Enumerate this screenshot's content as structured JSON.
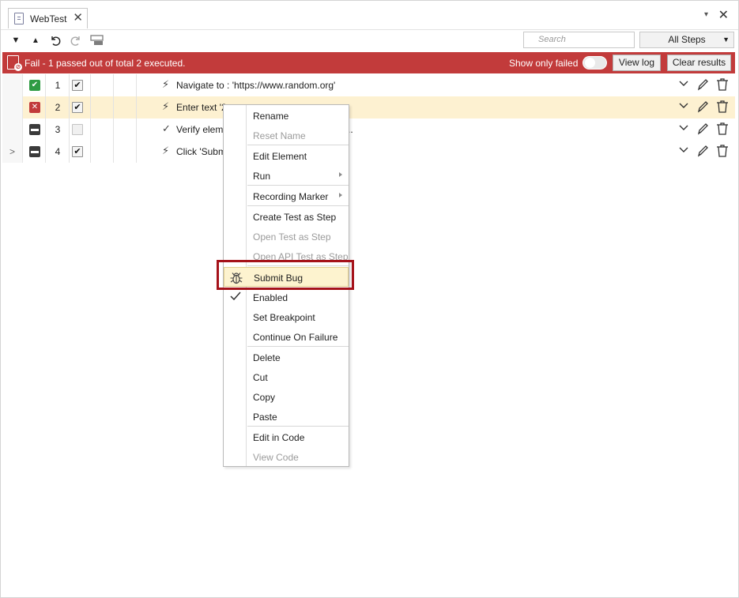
{
  "tab": {
    "title": "WebTest",
    "close": "✕"
  },
  "window": {
    "menu": "▾",
    "close": "✕"
  },
  "toolbar": {
    "collapse_all": "▼",
    "expand_all": "▲",
    "search_placeholder": "Search",
    "steps_filter": "All Steps",
    "steps_caret": "▼"
  },
  "status": {
    "message": "Fail - 1 passed out of total 2 executed.",
    "show_only_failed": "Show only failed",
    "show_only_failed_on": false,
    "view_log": "View log",
    "clear_results": "Clear results",
    "color": "#c23b3b"
  },
  "steps": [
    {
      "num": "1",
      "result": "pass",
      "result_glyph": "✔",
      "enabled": true,
      "check_glyph": "✔",
      "icon": "⚡",
      "text": "Navigate to : 'https://www.random.org'",
      "expander": ""
    },
    {
      "num": "2",
      "result": "fail",
      "result_glyph": "✕",
      "enabled": true,
      "check_glyph": "✔",
      "icon": "⚡",
      "text": "Enter text '2",
      "expander": ""
    },
    {
      "num": "3",
      "result": "skip",
      "result_glyph": "▬",
      "enabled": false,
      "check_glyph": "",
      "icon": "✓",
      "text": "Verify elem",
      "text_tail": "..",
      "expander": ""
    },
    {
      "num": "4",
      "result": "skip",
      "result_glyph": "▬",
      "enabled": true,
      "check_glyph": "✔",
      "icon": "⚡",
      "text": "Click 'Subm",
      "expander": ">"
    }
  ],
  "context_menu": {
    "items": [
      {
        "label": "Rename",
        "disabled": false
      },
      {
        "label": "Reset Name",
        "disabled": true
      },
      {
        "label": "Edit Element",
        "disabled": false
      },
      {
        "label": "Run",
        "disabled": false,
        "submenu": true
      },
      {
        "label": "Recording Marker",
        "disabled": false,
        "submenu": true
      },
      {
        "label": "Create Test as Step",
        "disabled": false
      },
      {
        "label": "Open Test as Step",
        "disabled": true
      },
      {
        "label": "Open API Test as Step",
        "disabled": true
      },
      {
        "label": "Submit Bug",
        "disabled": false,
        "icon": "bug-icon",
        "highlighted": true
      },
      {
        "label": "Enabled",
        "disabled": false,
        "checked": true
      },
      {
        "label": "Set Breakpoint",
        "disabled": false
      },
      {
        "label": "Continue On Failure",
        "disabled": false
      },
      {
        "label": "Delete",
        "disabled": false
      },
      {
        "label": "Cut",
        "disabled": false
      },
      {
        "label": "Copy",
        "disabled": false
      },
      {
        "label": "Paste",
        "disabled": false
      },
      {
        "label": "Edit in Code",
        "disabled": false
      },
      {
        "label": "View Code",
        "disabled": true
      }
    ],
    "check_glyph": "✓",
    "bug_glyph": "🐞"
  }
}
